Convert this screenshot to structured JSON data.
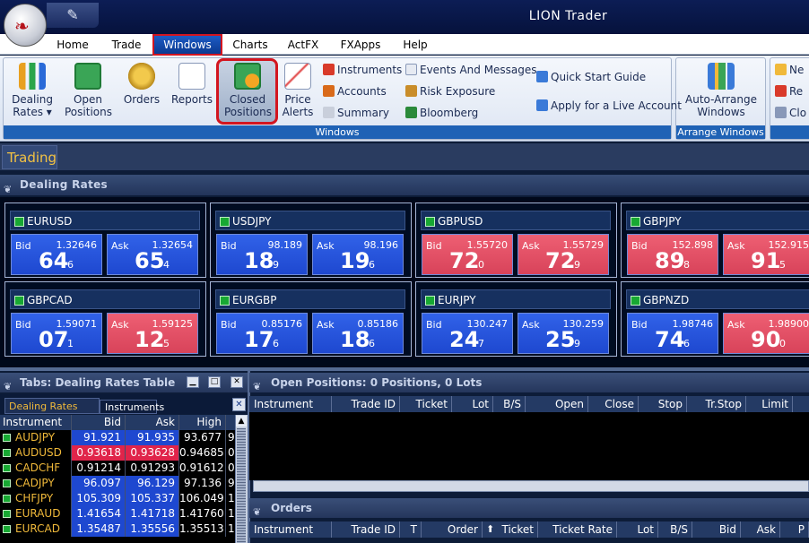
{
  "app": {
    "title": "LION Trader",
    "qat_icon": "tools-icon"
  },
  "menu_tabs": [
    "Home",
    "Trade",
    "Windows",
    "Charts",
    "ActFX",
    "FXApps",
    "Help"
  ],
  "ribbon": {
    "windows_group": {
      "label": "Windows",
      "big": [
        {
          "label": "Dealing\nRates ▾",
          "icon": "bar-chart-icon"
        },
        {
          "label": "Open\nPositions",
          "icon": "money-icon"
        },
        {
          "label": "Orders",
          "icon": "coins-icon"
        },
        {
          "label": "Reports",
          "icon": "report-icon"
        },
        {
          "label": "Closed\nPositions",
          "icon": "money-closed-icon"
        },
        {
          "label": "Price\nAlerts",
          "icon": "alert-chart-icon"
        }
      ],
      "small_col1": [
        "Instruments",
        "Accounts",
        "Summary"
      ],
      "small_col2": [
        "Events And Messages",
        "Risk Exposure",
        "Bloomberg"
      ],
      "small_col3": [
        "Quick Start Guide",
        "Apply for a Live Account"
      ]
    },
    "arrange_group": {
      "label": "Arrange Windows",
      "button": "Auto-Arrange\nWindows"
    },
    "partial_items": [
      "Ne",
      "Re",
      "Clo"
    ]
  },
  "doc_tab": "Trading",
  "dealing_rates": {
    "title": "Dealing Rates",
    "bid_label": "Bid",
    "ask_label": "Ask",
    "cells": [
      {
        "pair": "EURUSD",
        "bid_full": "1.32646",
        "bid_big": "64",
        "bid_pip": "6",
        "ask_full": "1.32654",
        "ask_big": "65",
        "ask_pip": "4",
        "bid_color": "blue",
        "ask_color": "blue"
      },
      {
        "pair": "USDJPY",
        "bid_full": "98.189",
        "bid_big": "18",
        "bid_pip": "9",
        "ask_full": "98.196",
        "ask_big": "19",
        "ask_pip": "6",
        "bid_color": "blue",
        "ask_color": "blue"
      },
      {
        "pair": "GBPUSD",
        "bid_full": "1.55720",
        "bid_big": "72",
        "bid_pip": "0",
        "ask_full": "1.55729",
        "ask_big": "72",
        "ask_pip": "9",
        "bid_color": "red",
        "ask_color": "red"
      },
      {
        "pair": "GBPJPY",
        "bid_full": "152.898",
        "bid_big": "89",
        "bid_pip": "8",
        "ask_full": "152.915",
        "ask_big": "91",
        "ask_pip": "5",
        "bid_color": "red",
        "ask_color": "red"
      },
      {
        "pair": "GBPCAD",
        "bid_full": "1.59071",
        "bid_big": "07",
        "bid_pip": "1",
        "ask_full": "1.59125",
        "ask_big": "12",
        "ask_pip": "5",
        "bid_color": "blue",
        "ask_color": "red"
      },
      {
        "pair": "EURGBP",
        "bid_full": "0.85176",
        "bid_big": "17",
        "bid_pip": "6",
        "ask_full": "0.85186",
        "ask_big": "18",
        "ask_pip": "6",
        "bid_color": "blue",
        "ask_color": "blue"
      },
      {
        "pair": "EURJPY",
        "bid_full": "130.247",
        "bid_big": "24",
        "bid_pip": "7",
        "ask_full": "130.259",
        "ask_big": "25",
        "ask_pip": "9",
        "bid_color": "blue",
        "ask_color": "blue"
      },
      {
        "pair": "GBPNZD",
        "bid_full": "1.98746",
        "bid_big": "74",
        "bid_pip": "6",
        "ask_full": "1.98900",
        "ask_big": "90",
        "ask_pip": "0",
        "bid_color": "blue",
        "ask_color": "red"
      }
    ]
  },
  "tabs_panel": {
    "title": "Tabs: Dealing Rates Table",
    "tab1": "Dealing Rates Table",
    "tab2": "Instruments",
    "columns": [
      "Instrument",
      "Bid",
      "Ask",
      "High"
    ],
    "rows": [
      {
        "instrument": "AUDJPY",
        "bid": "91.921",
        "ask": "91.935",
        "high": "93.677",
        "extra": "9",
        "bid_bg": "#1e48d0",
        "ask_bg": "#1e48d0"
      },
      {
        "instrument": "AUDUSD",
        "bid": "0.93618",
        "ask": "0.93628",
        "high": "0.94685",
        "extra": "0",
        "bid_bg": "#e0244a",
        "ask_bg": "#e0244a"
      },
      {
        "instrument": "CADCHF",
        "bid": "0.91214",
        "ask": "0.91293",
        "high": "0.91612",
        "extra": "0",
        "bid_bg": "#000",
        "ask_bg": "#000"
      },
      {
        "instrument": "CADJPY",
        "bid": "96.097",
        "ask": "96.129",
        "high": "97.136",
        "extra": "9",
        "bid_bg": "#1e48d0",
        "ask_bg": "#1e48d0"
      },
      {
        "instrument": "CHFJPY",
        "bid": "105.309",
        "ask": "105.337",
        "high": "106.049",
        "extra": "1",
        "bid_bg": "#1e48d0",
        "ask_bg": "#1e48d0"
      },
      {
        "instrument": "EURAUD",
        "bid": "1.41654",
        "ask": "1.41718",
        "high": "1.41760",
        "extra": "1",
        "bid_bg": "#1e48d0",
        "ask_bg": "#1e48d0"
      },
      {
        "instrument": "EURCAD",
        "bid": "1.35487",
        "ask": "1.35556",
        "high": "1.35513",
        "extra": "1",
        "bid_bg": "#1e48d0",
        "ask_bg": "#1e48d0"
      }
    ]
  },
  "open_positions": {
    "title": "Open Positions: 0 Positions, 0 Lots",
    "columns": [
      "Instrument",
      "Trade ID",
      "Ticket",
      "Lot",
      "B/S",
      "Open",
      "Close",
      "Stop",
      "Tr.Stop",
      "Limit"
    ]
  },
  "orders": {
    "title": "Orders",
    "columns": [
      "Instrument",
      "Trade ID",
      "T",
      "Order",
      "Ticket",
      "Ticket Rate",
      "Lot",
      "B/S",
      "Bid",
      "Ask",
      "P"
    ]
  }
}
